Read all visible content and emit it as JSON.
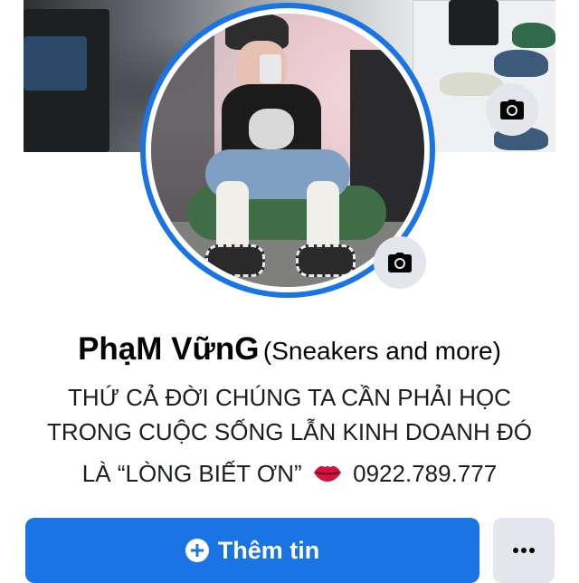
{
  "profile": {
    "name": "PhạM VữnG",
    "subtitle": "(Sneakers and more)",
    "bio_line1": "THỨ CẢ ĐỜI CHÚNG TA CẦN PHẢI HỌC",
    "bio_line2": "TRONG CUỘC SỐNG LẪN KINH DOANH ĐÓ",
    "bio_line3_text": "LÀ “LÒNG BIẾT ƠN”",
    "bio_line3_phone": "0922.789.777",
    "bio_emoji": "kiss-mark-lips"
  },
  "actions": {
    "add_story_label": "Thêm tin",
    "add_story_icon": "plus-circle-icon",
    "more_icon": "more-horizontal-icon",
    "cover_camera_icon": "camera-icon",
    "avatar_camera_icon": "camera-icon"
  },
  "colors": {
    "accent": "#1b74e4",
    "button_gray": "#e4e6eb",
    "text": "#050505"
  }
}
